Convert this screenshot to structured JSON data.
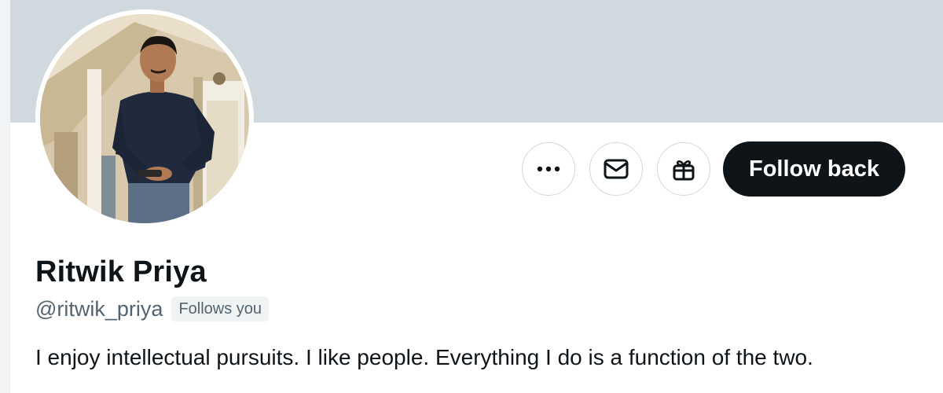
{
  "profile": {
    "display_name": "Ritwik Priya",
    "handle": "@ritwik_priya",
    "follows_you_badge": "Follows you",
    "bio": "I enjoy intellectual pursuits. I like people. Everything I do is a function of the two."
  },
  "actions": {
    "more_icon": "more-dots-icon",
    "message_icon": "envelope-icon",
    "gift_icon": "gift-icon",
    "follow_label": "Follow back"
  },
  "colors": {
    "banner": "#cfd9de",
    "follow_button": "#0f1419",
    "secondary_text": "#536471",
    "primary_text": "#0f1419"
  }
}
